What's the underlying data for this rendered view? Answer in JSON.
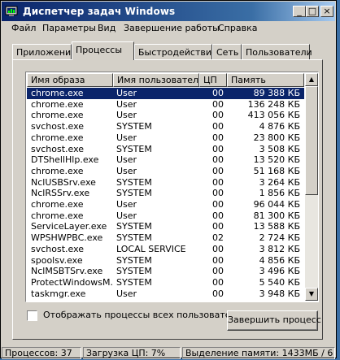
{
  "window": {
    "title": "Диспетчер задач Windows"
  },
  "title_buttons": {
    "minimize": "_",
    "maximize": "□",
    "close": "×"
  },
  "menu": [
    "Файл",
    "Параметры",
    "Вид",
    "Завершение работы",
    "Справка"
  ],
  "tabs": [
    "Приложения",
    "Процессы",
    "Быстродействие",
    "Сеть",
    "Пользователи"
  ],
  "active_tab": "Процессы",
  "columns": [
    "Имя образа",
    "Имя пользователя",
    "ЦП",
    "Память"
  ],
  "processes": [
    {
      "name": "chrome.exe",
      "user": "User",
      "cpu": "00",
      "mem": "89 388 КБ",
      "selected": true
    },
    {
      "name": "chrome.exe",
      "user": "User",
      "cpu": "00",
      "mem": "136 248 КБ"
    },
    {
      "name": "chrome.exe",
      "user": "User",
      "cpu": "00",
      "mem": "413 056 КБ"
    },
    {
      "name": "svchost.exe",
      "user": "SYSTEM",
      "cpu": "00",
      "mem": "4 876 КБ"
    },
    {
      "name": "chrome.exe",
      "user": "User",
      "cpu": "00",
      "mem": "23 800 КБ"
    },
    {
      "name": "svchost.exe",
      "user": "SYSTEM",
      "cpu": "00",
      "mem": "3 508 КБ"
    },
    {
      "name": "DTShellHlp.exe",
      "user": "User",
      "cpu": "00",
      "mem": "13 520 КБ"
    },
    {
      "name": "chrome.exe",
      "user": "User",
      "cpu": "00",
      "mem": "51 168 КБ"
    },
    {
      "name": "NclUSBSrv.exe",
      "user": "SYSTEM",
      "cpu": "00",
      "mem": "3 264 КБ"
    },
    {
      "name": "NclRSSrv.exe",
      "user": "SYSTEM",
      "cpu": "00",
      "mem": "1 856 КБ"
    },
    {
      "name": "chrome.exe",
      "user": "User",
      "cpu": "00",
      "mem": "96 044 КБ"
    },
    {
      "name": "chrome.exe",
      "user": "User",
      "cpu": "00",
      "mem": "81 300 КБ"
    },
    {
      "name": "ServiceLayer.exe",
      "user": "SYSTEM",
      "cpu": "00",
      "mem": "13 588 КБ"
    },
    {
      "name": "WPSHWPBC.exe",
      "user": "SYSTEM",
      "cpu": "02",
      "mem": "2 724 КБ"
    },
    {
      "name": "svchost.exe",
      "user": "LOCAL SERVICE",
      "cpu": "00",
      "mem": "3 812 КБ"
    },
    {
      "name": "spoolsv.exe",
      "user": "SYSTEM",
      "cpu": "00",
      "mem": "4 856 КБ"
    },
    {
      "name": "NclMSBTSrv.exe",
      "user": "SYSTEM",
      "cpu": "00",
      "mem": "3 496 КБ"
    },
    {
      "name": "ProtectWindowsM...",
      "user": "SYSTEM",
      "cpu": "00",
      "mem": "5 540 КБ"
    },
    {
      "name": "taskmgr.exe",
      "user": "User",
      "cpu": "00",
      "mem": "3 948 КБ"
    }
  ],
  "show_all_label": "Отображать процессы всех пользователей",
  "show_all_checked": false,
  "end_process_label": "Завершить процесс",
  "status": {
    "processes": "Процессов: 37",
    "cpu": "Загрузка ЦП: 7%",
    "memory": "Выделение памяти: 1433МБ / 6"
  },
  "colors": {
    "title_start": "#0a246a",
    "title_end": "#a6caf0",
    "selection": "#0a246a",
    "face": "#d4d0c8"
  }
}
